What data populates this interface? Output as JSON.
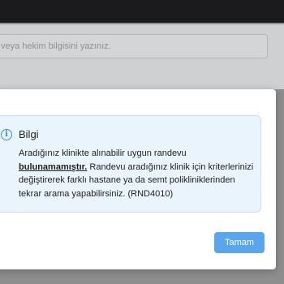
{
  "background": {
    "search_placeholder": "veya hekim bilgisini yazınız."
  },
  "dialog": {
    "icon": "info-icon",
    "title": "Bilgi",
    "message_pre": "Aradığınız klinikte alınabilir uygun randevu ",
    "message_emphasis": "bulunamamıştır.",
    "message_post": " Randevu aradığınız klinik için kriterlerinizi değiştirerek farklı hastane ya da semt polikliniklerinden tekrar arama yapabilirsiniz. (RND4010)",
    "ok_label": "Tamam"
  },
  "colors": {
    "accent": "#5aa6ee",
    "info_bg": "#eaf4fd",
    "info_icon": "#3d8fe0",
    "topbar": "#1b1b1d"
  }
}
